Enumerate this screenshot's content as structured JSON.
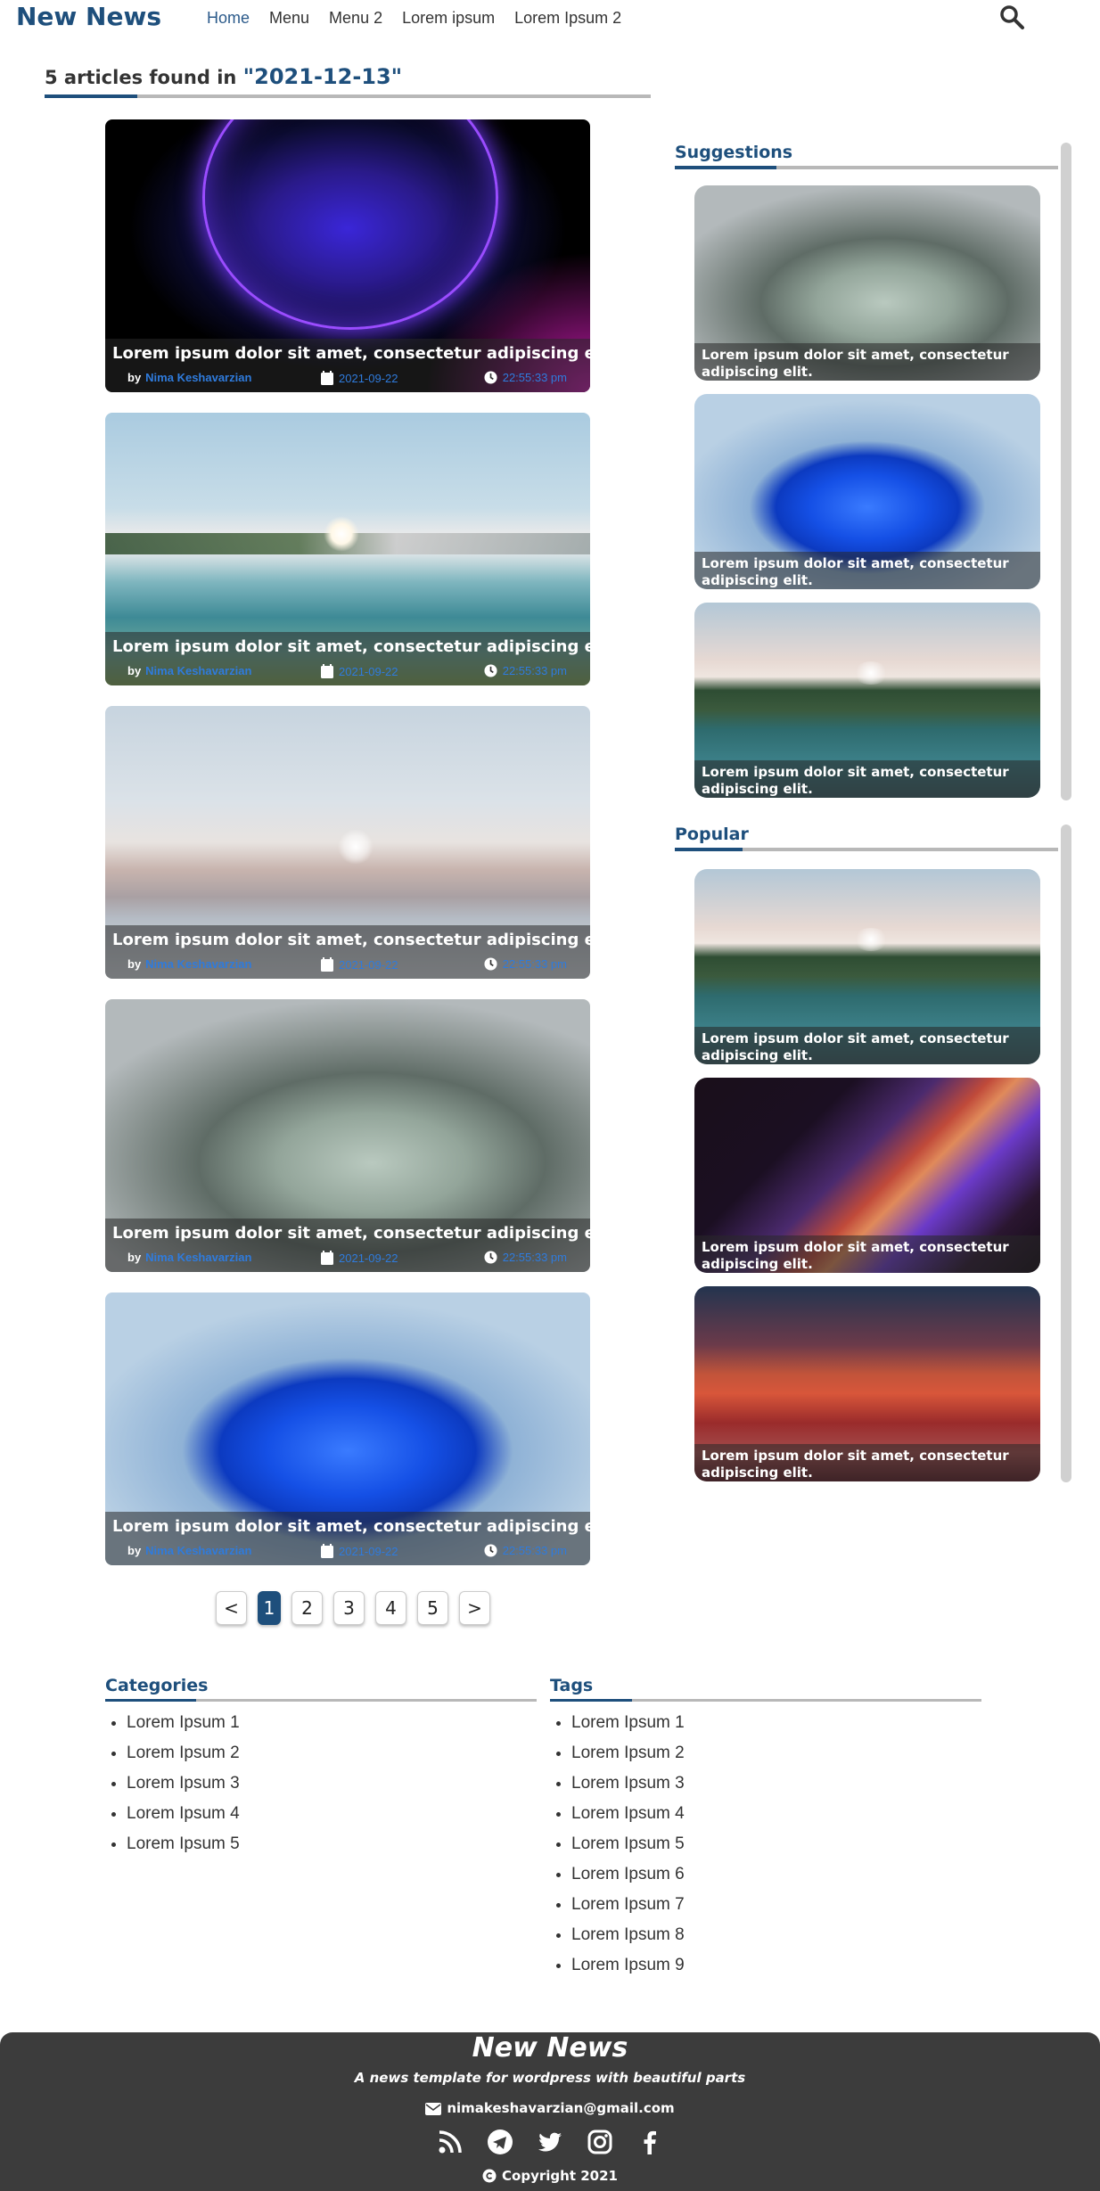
{
  "header": {
    "logo": "New News",
    "nav": [
      "Home",
      "Menu",
      "Menu 2",
      "Lorem ipsum",
      "Lorem Ipsum 2"
    ]
  },
  "results": {
    "prefix": "5 articles found in",
    "query": "\"2021-12-13\""
  },
  "articles": [
    {
      "title": "Lorem ipsum dolor sit amet, consectetur adipiscing elit.",
      "by": "by",
      "author": "Nima Keshavarzian",
      "date": "2021-09-22",
      "time": "22:55:33 pm",
      "image": "purple-glow-orb"
    },
    {
      "title": "Lorem ipsum dolor sit amet, consectetur adipiscing elit.",
      "by": "by",
      "author": "Nima Keshavarzian",
      "date": "2021-09-22",
      "time": "22:55:33 pm",
      "image": "lake-landscape"
    },
    {
      "title": "Lorem ipsum dolor sit amet, consectetur adipiscing elit.",
      "by": "by",
      "author": "Nima Keshavarzian",
      "date": "2021-09-22",
      "time": "22:55:33 pm",
      "image": "desert-dunes"
    },
    {
      "title": "Lorem ipsum dolor sit amet, consectetur adipiscing elit.",
      "by": "by",
      "author": "Nima Keshavarzian",
      "date": "2021-09-22",
      "time": "22:55:33 pm",
      "image": "sage-bloom"
    },
    {
      "title": "Lorem ipsum dolor sit amet, consectetur adipiscing elit.",
      "by": "by",
      "author": "Nima Keshavarzian",
      "date": "2021-09-22",
      "time": "22:55:33 pm",
      "image": "blue-bloom"
    }
  ],
  "pagination": {
    "prev": "<",
    "pages": [
      "1",
      "2",
      "3",
      "4",
      "5"
    ],
    "active": "1",
    "next": ">"
  },
  "suggestions": {
    "title": "Suggestions",
    "items": [
      {
        "title": "Lorem ipsum dolor sit amet, consectetur adipiscing elit.",
        "image": "sage-bloom"
      },
      {
        "title": "Lorem ipsum dolor sit amet, consectetur adipiscing elit.",
        "image": "blue-bloom"
      },
      {
        "title": "Lorem ipsum dolor sit amet, consectetur adipiscing elit.",
        "image": "forest-lake"
      }
    ]
  },
  "popular": {
    "title": "Popular",
    "items": [
      {
        "title": "Lorem ipsum dolor sit amet, consectetur adipiscing elit.",
        "image": "forest-lake"
      },
      {
        "title": "Lorem ipsum dolor sit amet, consectetur adipiscing elit.",
        "image": "colorful-wave"
      },
      {
        "title": "Lorem ipsum dolor sit amet, consectetur adipiscing elit.",
        "image": "red-dunes"
      }
    ]
  },
  "categories": {
    "title": "Categories",
    "items": [
      "Lorem Ipsum 1",
      "Lorem Ipsum 2",
      "Lorem Ipsum 3",
      "Lorem Ipsum 4",
      "Lorem Ipsum 5"
    ]
  },
  "tags": {
    "title": "Tags",
    "items": [
      "Lorem Ipsum 1",
      "Lorem Ipsum 2",
      "Lorem Ipsum 3",
      "Lorem Ipsum 4",
      "Lorem Ipsum 5",
      "Lorem Ipsum 6",
      "Lorem Ipsum 7",
      "Lorem Ipsum 8",
      "Lorem Ipsum 9"
    ]
  },
  "footer": {
    "title": "New News",
    "subtitle": "A news template for wordpress with beautiful parts",
    "email": "nimakeshavarzian@gmail.com",
    "social": [
      "rss-icon",
      "telegram-icon",
      "twitter-icon",
      "instagram-icon",
      "facebook-icon"
    ],
    "copyright": "Copyright 2021"
  },
  "colors": {
    "brand": "#1e4f7c",
    "link": "#2f7bdc",
    "footer_bg": "#3c3c3c"
  }
}
